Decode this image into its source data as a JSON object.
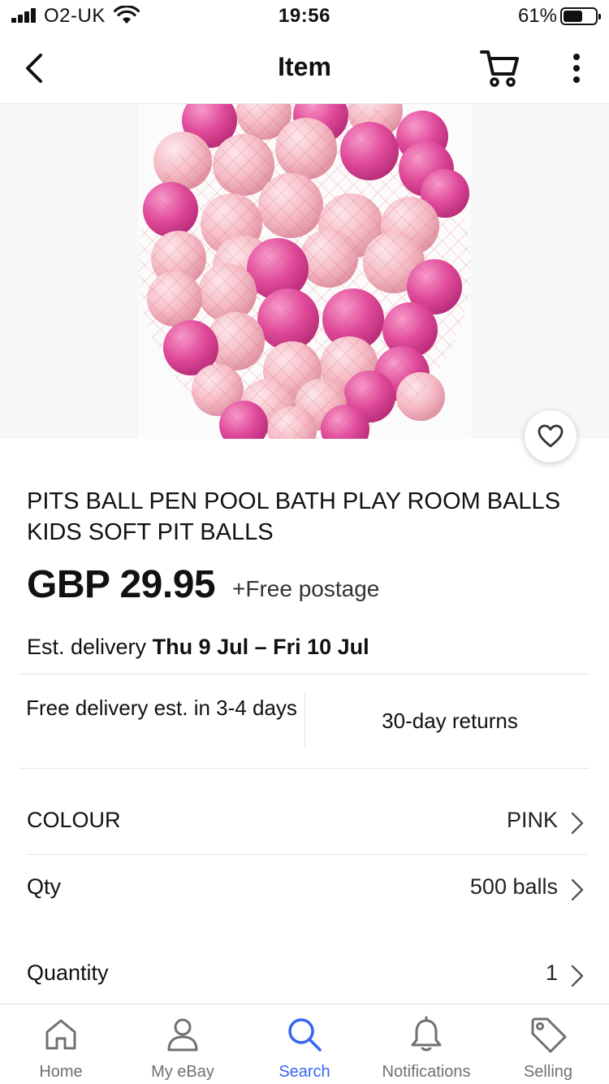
{
  "status_bar": {
    "carrier": "O2-UK",
    "time": "19:56",
    "battery_percent": "61%",
    "battery_level": 0.61
  },
  "nav": {
    "title": "Item",
    "back_icon": "chevron-left-icon",
    "cart_icon": "cart-icon",
    "more_icon": "more-vertical-icon"
  },
  "product": {
    "title": "PITS  BALL PEN POOL BATH PLAY ROOM BALLS KIDS SOFT PIT BALLS",
    "price": "GBP 29.95",
    "postage": "+Free postage",
    "delivery_label": "Est. delivery",
    "delivery_dates": "Thu 9 Jul – Fri 10 Jul",
    "image_description_icon": "product-image",
    "favourite_icon": "heart-icon"
  },
  "info": {
    "free_delivery": "Free delivery est. in 3-4 days",
    "returns": "30-day returns"
  },
  "variations": [
    {
      "label": "COLOUR",
      "value": "PINK"
    },
    {
      "label": "Qty",
      "value": "500 balls"
    },
    {
      "label": "Quantity",
      "value": "1"
    }
  ],
  "tabs": [
    {
      "label": "Home",
      "icon": "home-icon"
    },
    {
      "label": "My eBay",
      "icon": "person-icon"
    },
    {
      "label": "Search",
      "icon": "search-icon",
      "active": true
    },
    {
      "label": "Notifications",
      "icon": "bell-icon"
    },
    {
      "label": "Selling",
      "icon": "tag-icon"
    }
  ],
  "colors": {
    "accent": "#3665f3",
    "inactive_tab": "#707070",
    "ball_light": "#f2b9c4",
    "ball_dark": "#e0489a"
  }
}
